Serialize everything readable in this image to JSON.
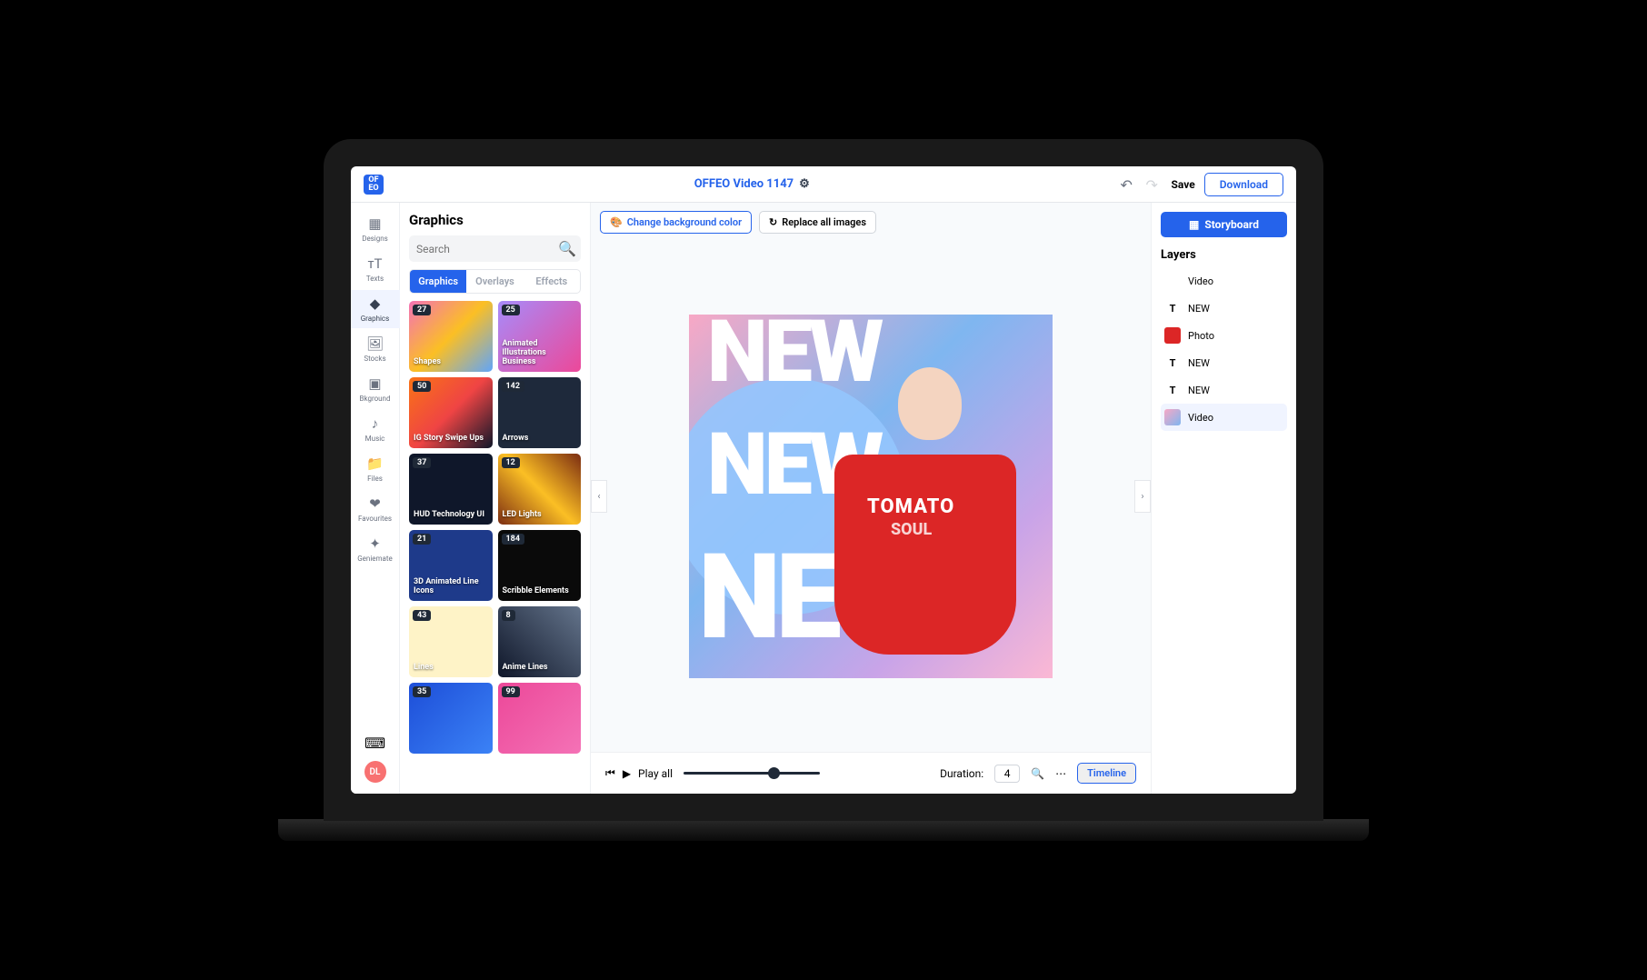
{
  "header": {
    "title": "OFFEO Video 1147",
    "save": "Save",
    "download": "Download"
  },
  "leftnav": {
    "items": [
      "Designs",
      "Texts",
      "Graphics",
      "Stocks",
      "Bkground",
      "Music",
      "Files",
      "Favourites",
      "Geniemate"
    ],
    "active_index": 2,
    "avatar": "DL"
  },
  "panel": {
    "title": "Graphics",
    "search_placeholder": "Search",
    "tabs": [
      "Graphics",
      "Overlays",
      "Effects"
    ],
    "active_tab": 0,
    "cards": [
      {
        "count": "27",
        "title": "Shapes"
      },
      {
        "count": "25",
        "title": "Animated Illustrations Business"
      },
      {
        "count": "50",
        "title": "IG Story Swipe Ups"
      },
      {
        "count": "142",
        "title": "Arrows"
      },
      {
        "count": "37",
        "title": "HUD Technology UI"
      },
      {
        "count": "12",
        "title": "LED Lights"
      },
      {
        "count": "21",
        "title": "3D Animated Line Icons"
      },
      {
        "count": "184",
        "title": "Scribble Elements"
      },
      {
        "count": "43",
        "title": "Lines"
      },
      {
        "count": "8",
        "title": "Anime Lines"
      },
      {
        "count": "35",
        "title": ""
      },
      {
        "count": "99",
        "title": ""
      }
    ]
  },
  "canvas_toolbar": {
    "change_bg": "Change background color",
    "replace_all": "Replace all images"
  },
  "canvas": {
    "text1": "NEW",
    "text2": "NEW",
    "text3": "NEW",
    "shirt_line1": "TOMATO",
    "shirt_line2": "SOUL"
  },
  "playbar": {
    "play_all": "Play all",
    "duration_label": "Duration:",
    "duration_value": "4",
    "timeline": "Timeline"
  },
  "right": {
    "storyboard": "Storyboard",
    "layers_title": "Layers",
    "layers": [
      {
        "type": "blank",
        "label": "Video"
      },
      {
        "type": "T",
        "label": "NEW"
      },
      {
        "type": "photo",
        "label": "Photo"
      },
      {
        "type": "T",
        "label": "NEW"
      },
      {
        "type": "T",
        "label": "NEW"
      },
      {
        "type": "video",
        "label": "Video"
      }
    ],
    "active_layer": 5
  }
}
